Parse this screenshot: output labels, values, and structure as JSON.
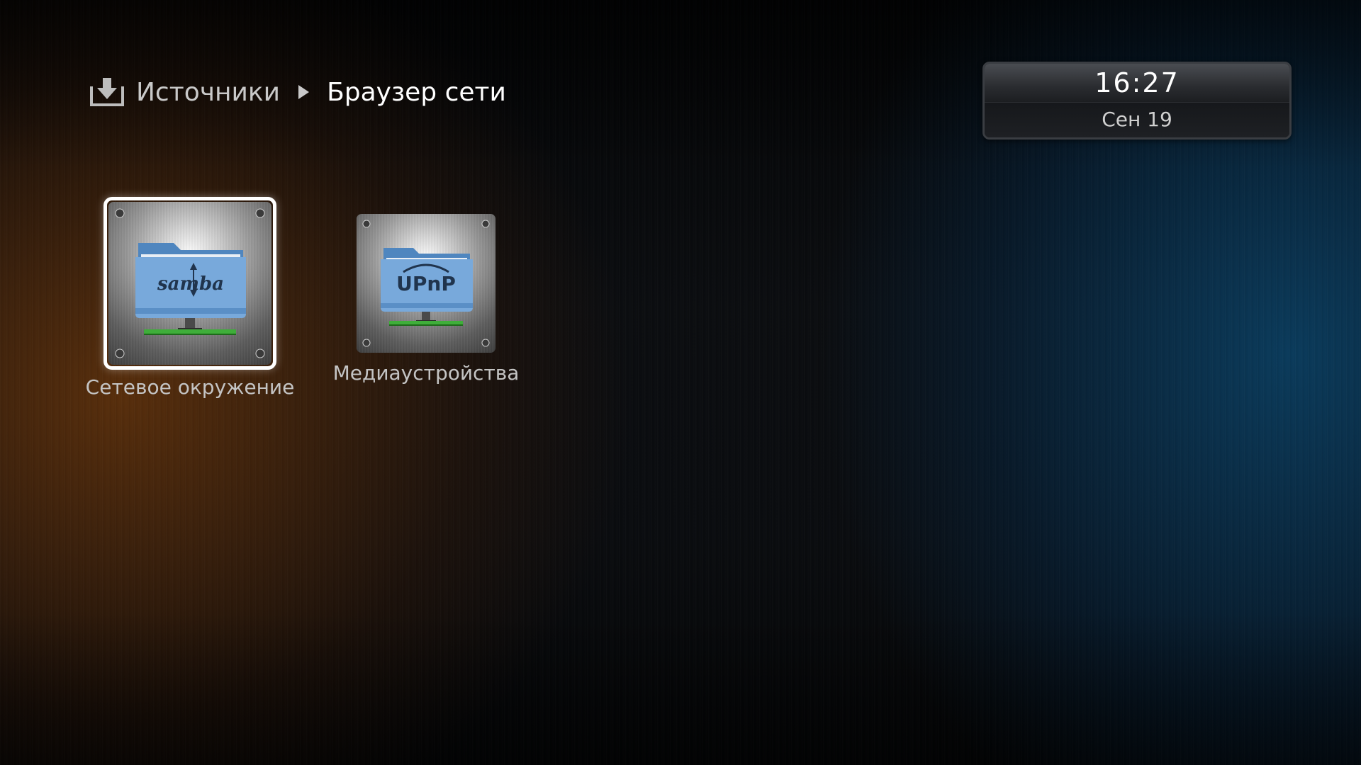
{
  "breadcrumb": {
    "root": "Источники",
    "current": "Браузер сети"
  },
  "clock": {
    "time": "16:27",
    "date": "Сен 19"
  },
  "sources": [
    {
      "label": "Сетевое окружение",
      "icon": "samba-network-folder-icon",
      "icon_text": "samba",
      "selected": true
    },
    {
      "label": "Медиаустройства",
      "icon": "upnp-network-folder-icon",
      "icon_text": "UPnP",
      "selected": false
    }
  ],
  "colors": {
    "background": "#0a0c0f",
    "accent_warm": "#783c0a",
    "accent_cool": "#0a466e",
    "selection": "#ffffff",
    "folder_blue": "#6fa3d6",
    "network_green": "#3fae3a"
  }
}
